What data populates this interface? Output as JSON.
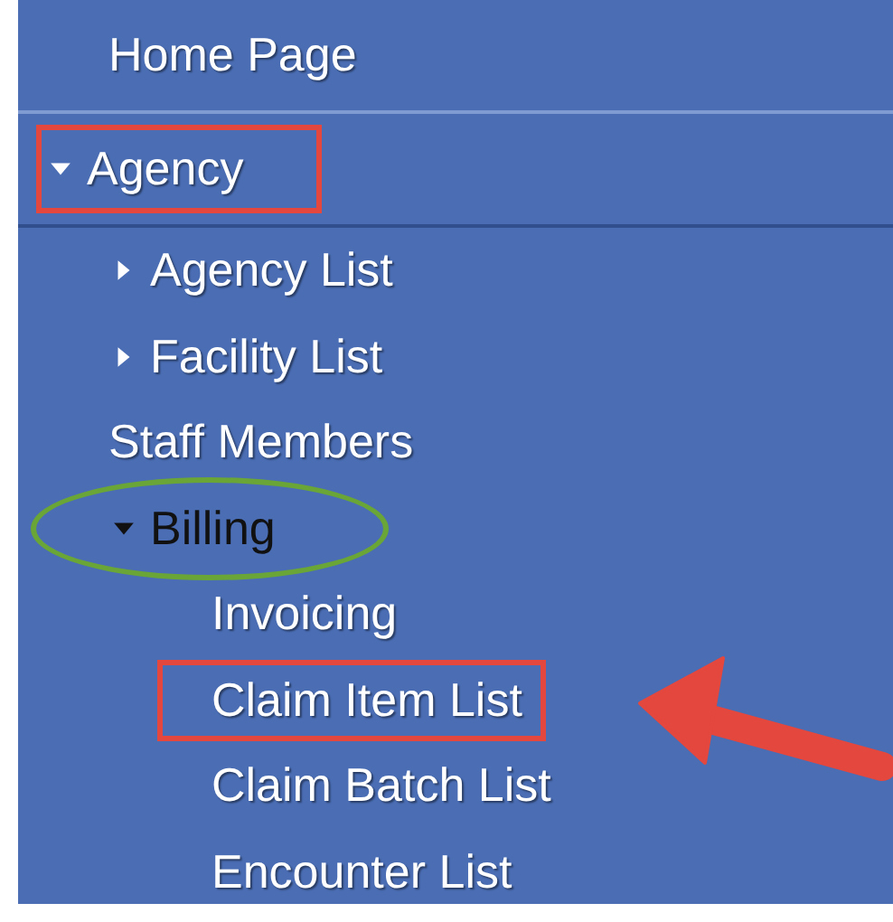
{
  "menu": [
    {
      "label": "Home Page",
      "selected": false
    },
    {
      "label": "Agency",
      "expanded": true,
      "selected": false,
      "boxed": true,
      "children": [
        {
          "label": "Agency List",
          "expanded": false,
          "selected": false
        },
        {
          "label": "Facility List",
          "expanded": false,
          "selected": false
        },
        {
          "label": "Staff Members",
          "selected": false
        },
        {
          "label": "Billing",
          "expanded": true,
          "selected": true,
          "circled": true,
          "children": [
            {
              "label": "Invoicing",
              "selected": false
            },
            {
              "label": "Claim Item List",
              "selected": false,
              "boxed": true,
              "pointer": true
            },
            {
              "label": "Claim Batch List",
              "selected": false
            },
            {
              "label": "Encounter List",
              "selected": false
            }
          ]
        }
      ]
    }
  ]
}
